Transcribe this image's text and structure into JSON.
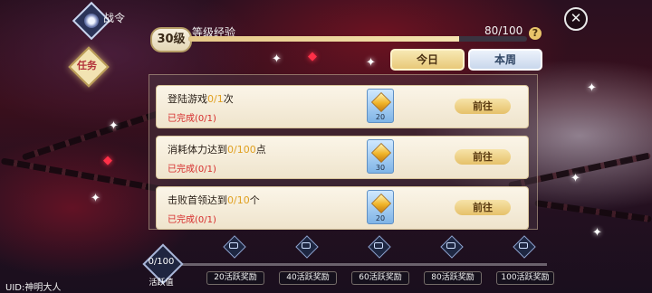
{
  "header": {
    "mode_title": "战令",
    "task_tab_label": "任务",
    "level_badge": "30级",
    "level_title": "等级经验",
    "level_progress": "80/100",
    "level_fraction": 0.8,
    "help_icon": "question-icon",
    "close_icon": "close-icon"
  },
  "tabs": [
    {
      "label": "今日",
      "active": true
    },
    {
      "label": "本周",
      "active": false
    }
  ],
  "tasks": [
    {
      "pre": "登陆游戏",
      "cur": "0/1",
      "post": "次",
      "status": "已完成(0/1)",
      "reward": "20",
      "action": "前往"
    },
    {
      "pre": "消耗体力达到",
      "cur": "0/100",
      "post": "点",
      "status": "已完成(0/1)",
      "reward": "30",
      "action": "前往"
    },
    {
      "pre": "击败首领达到",
      "cur": "0/10",
      "post": "个",
      "status": "已完成(0/1)",
      "reward": "20",
      "action": "前往"
    }
  ],
  "activity": {
    "value": "0/100",
    "label": "活跃值",
    "milestones": [
      "20活跃奖励",
      "40活跃奖励",
      "60活跃奖励",
      "80活跃奖励",
      "100活跃奖励"
    ]
  },
  "uid": "UID:神明大人",
  "colors": {
    "highlight": "#e0a020",
    "status_red": "#d62a2a",
    "gold": "#e6c16a"
  }
}
